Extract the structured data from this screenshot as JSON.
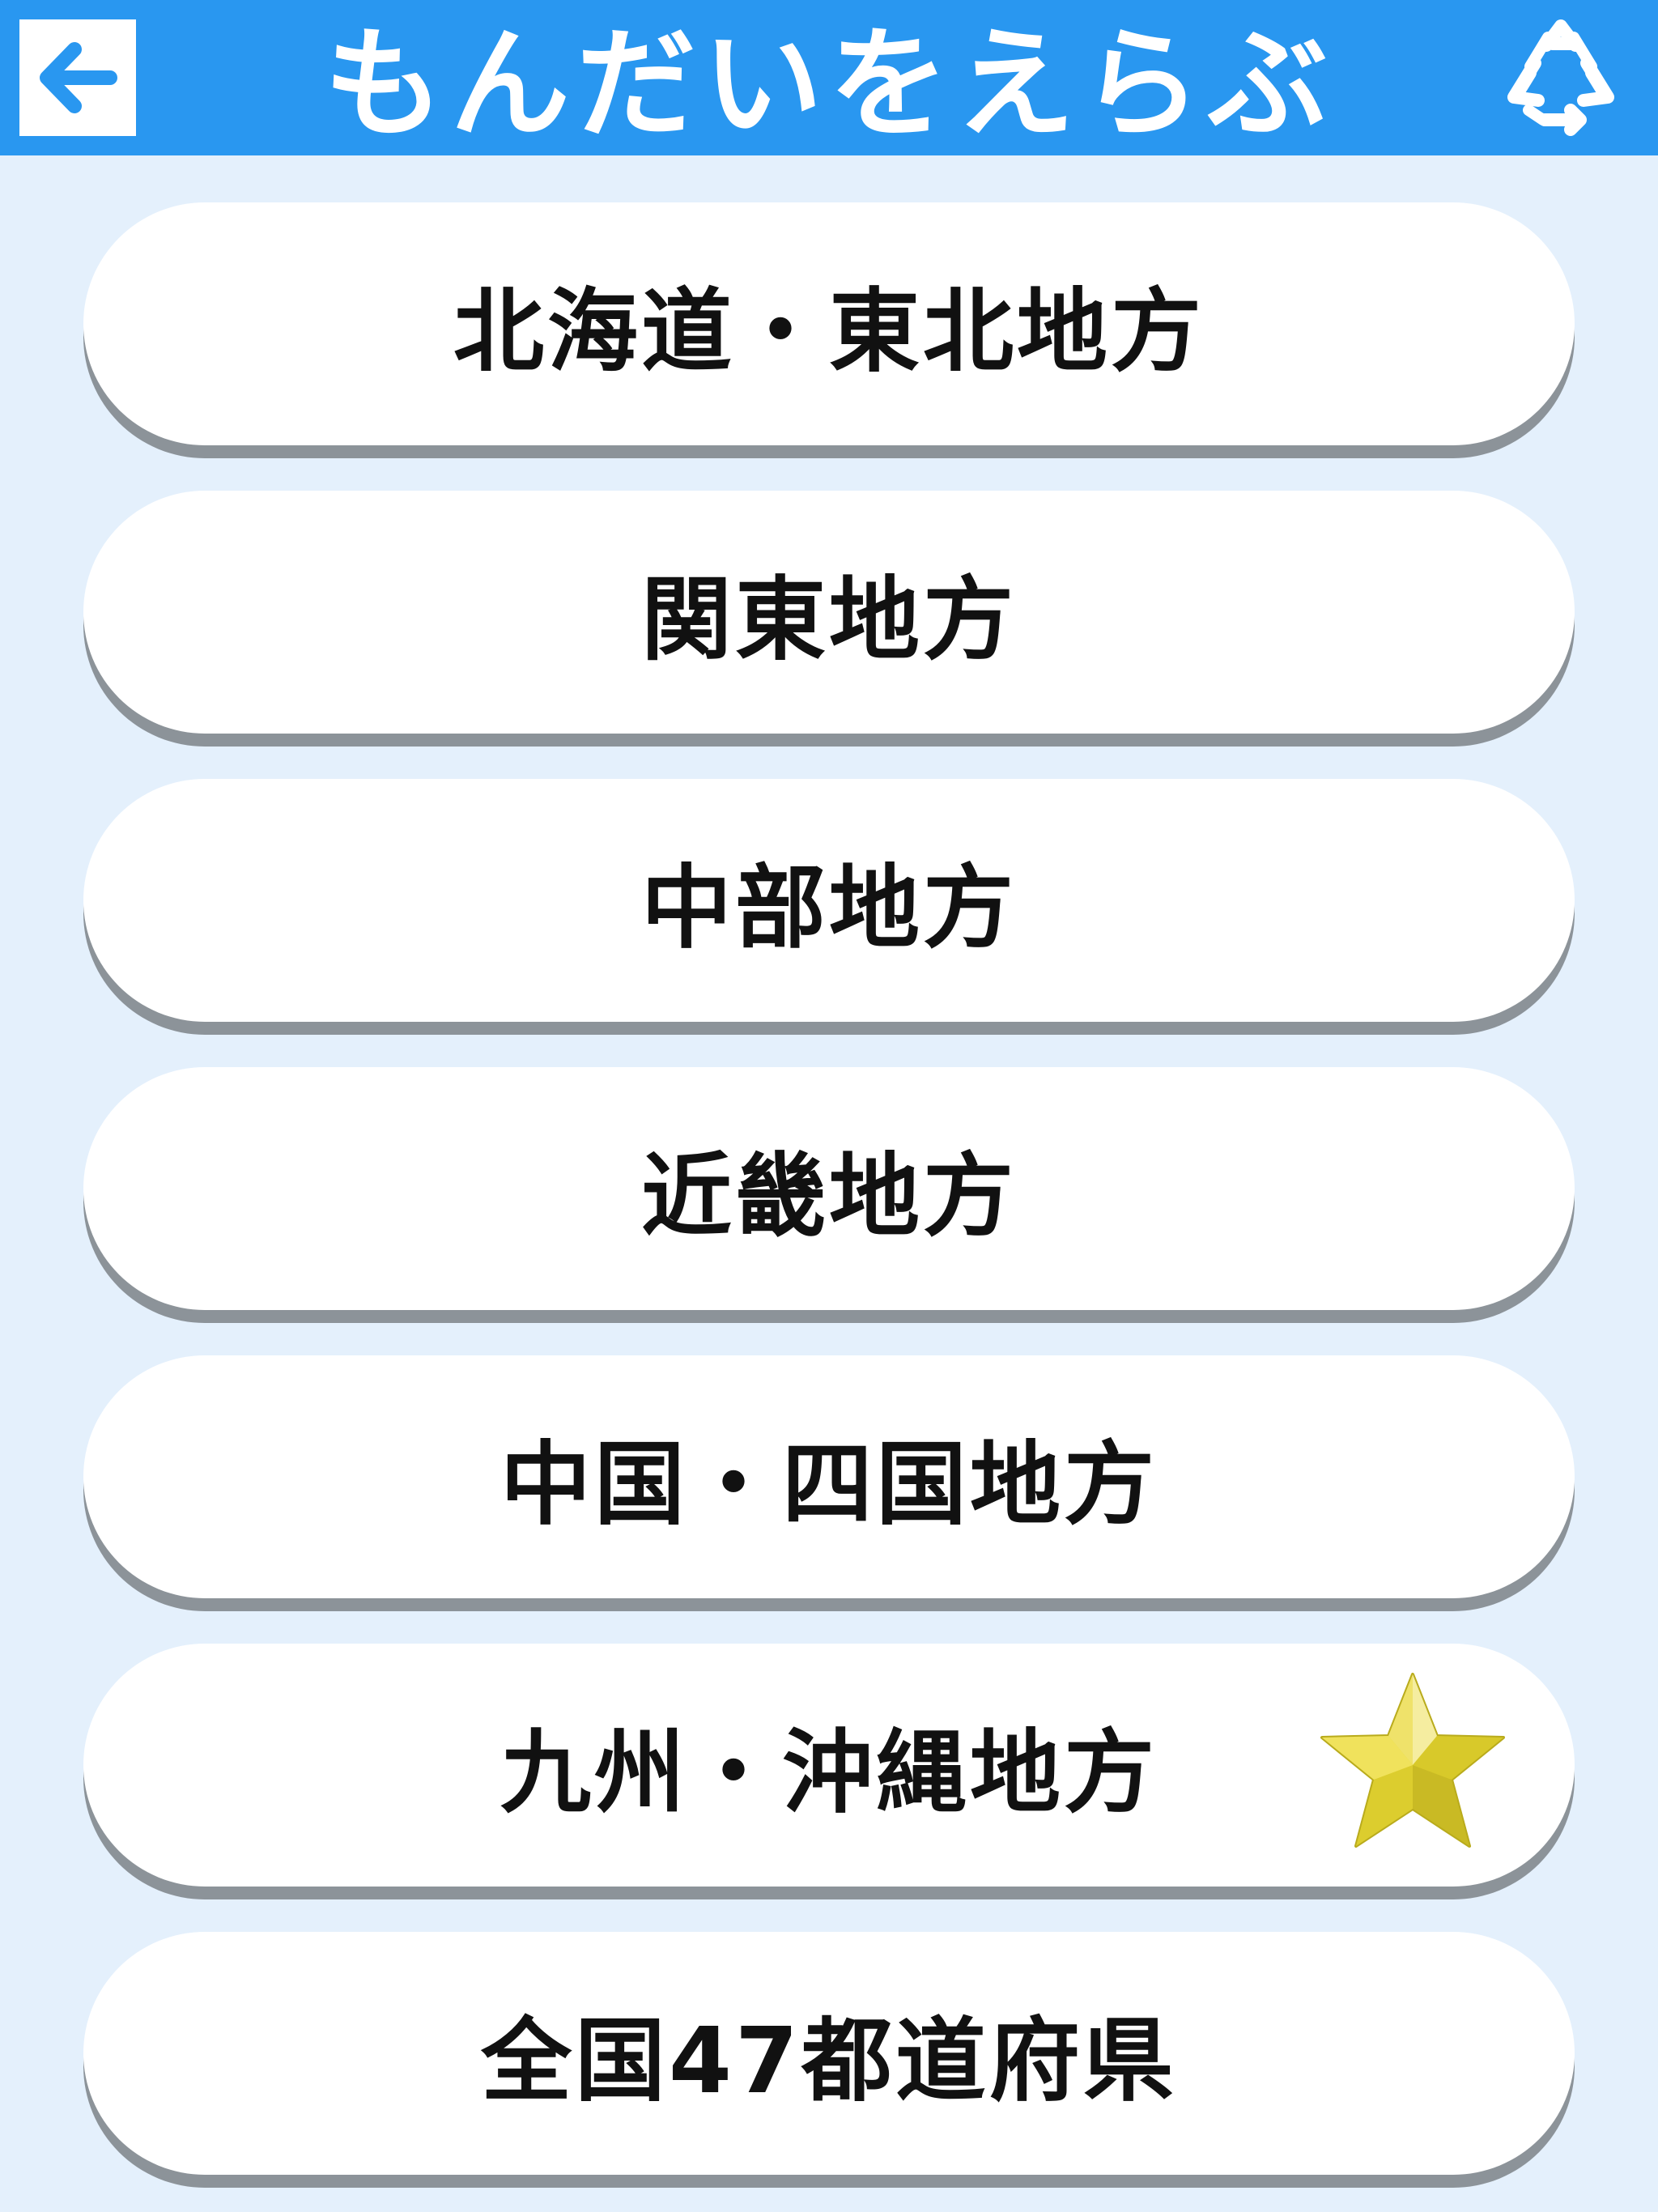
{
  "header": {
    "title": "もんだいをえらぶ",
    "back_icon": "arrow-left-icon",
    "reset_icon": "recycle-icon",
    "background_color": "#2997f0"
  },
  "menu": {
    "items": [
      {
        "label": "北海道・東北地方",
        "completed": false
      },
      {
        "label": "関東地方",
        "completed": false
      },
      {
        "label": "中部地方",
        "completed": false
      },
      {
        "label": "近畿地方",
        "completed": false
      },
      {
        "label": "中国・四国地方",
        "completed": false
      },
      {
        "label": "九州・沖縄地方",
        "completed": true,
        "badge_icon": "star-icon"
      },
      {
        "label": "全国47都道府県",
        "completed": false
      }
    ]
  },
  "colors": {
    "page_background": "#e4f0fc",
    "button_face": "#ffffff",
    "button_shadow": "#8c9399",
    "star": "#e8d92f"
  }
}
